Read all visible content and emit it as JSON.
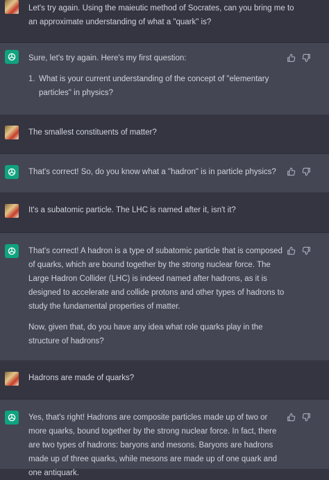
{
  "colors": {
    "page_bg": "#343541",
    "assistant_bg": "#444654",
    "text": "#d1d5db",
    "bot_avatar_bg": "#10a37f",
    "icon": "#acacbe"
  },
  "icons": {
    "bot_avatar": "openai-logo-icon",
    "thumbs_up": "thumbs-up-icon",
    "thumbs_down": "thumbs-down-icon"
  },
  "messages": [
    {
      "role": "user",
      "text": "Let's try again. Using the maieutic method of Socrates, can you bring me to an approximate understanding of what a \"quark\" is?"
    },
    {
      "role": "assistant",
      "intro": "Sure, let's try again. Here's my first question:",
      "list": [
        {
          "num": "1.",
          "text": "What is your current understanding of the concept of \"elementary particles\" in physics?"
        }
      ]
    },
    {
      "role": "user",
      "text": "The smallest constituents of matter?"
    },
    {
      "role": "assistant",
      "text": "That's correct! So, do you know what a \"hadron\" is in particle physics?"
    },
    {
      "role": "user",
      "text": "It's a  subatomic particle.  The LHC is named after it, isn't it?"
    },
    {
      "role": "assistant",
      "text": "That's correct! A hadron is a type of subatomic particle that is composed of quarks, which are bound together by the strong nuclear force. The Large Hadron Collider (LHC) is indeed named after hadrons, as it is designed to accelerate and collide protons and other types of hadrons to study the fundamental properties of matter.",
      "text2": "Now, given that, do you have any idea what role quarks play in the structure of hadrons?"
    },
    {
      "role": "user",
      "text": "Hadrons are made of quarks?"
    },
    {
      "role": "assistant",
      "text": "Yes, that's right! Hadrons are composite particles made up of two or more quarks, bound together by the strong nuclear force. In fact, there are two types of hadrons: baryons and mesons. Baryons are hadrons made up of three quarks, while mesons are made up of one quark and one antiquark."
    }
  ]
}
